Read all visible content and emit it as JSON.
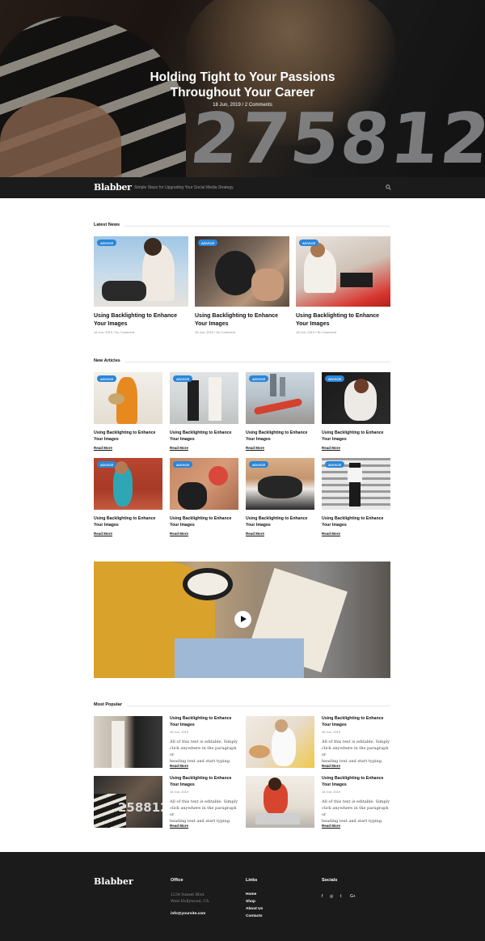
{
  "hero": {
    "title_line1": "Holding Tight to Your Passions",
    "title_line2": "Throughout Your Career",
    "meta": "18 Jun, 2019  /  2 Comments",
    "numbers": "275812"
  },
  "navbar": {
    "logo": "Blabber",
    "tagline": "Simple Steps for Upgrading Your Social Media Strategy"
  },
  "latest_news": {
    "heading": "Latest News",
    "items": [
      {
        "badge": "ADVICE",
        "title1": "Using Backlighting to Enhance",
        "title2": "Your Images",
        "meta": "18 Jun, 2019  /  No Comment"
      },
      {
        "badge": "ADVICE",
        "title1": "Using Backlighting to Enhance",
        "title2": "Your Images",
        "meta": "18 Jun, 2019  /  No Comment"
      },
      {
        "badge": "ADVICE",
        "title1": "Using Backlighting to Enhance",
        "title2": "Your Images",
        "meta": "18 Jun, 2019  /  No Comment"
      }
    ]
  },
  "new_articles": {
    "heading": "New Articles",
    "items": [
      {
        "badge": "ADVICE",
        "title1": "Using Backlighting to Enhance",
        "title2": "Your Images",
        "read_more": "Read More"
      },
      {
        "badge": "ADVICE",
        "title1": "Using Backlighting to Enhance",
        "title2": "Your Images",
        "read_more": "Read More"
      },
      {
        "badge": "ADVICE",
        "title1": "Using Backlighting to Enhance",
        "title2": "Your Images",
        "read_more": "Read More"
      },
      {
        "badge": "ADVICE",
        "title1": "Using Backlighting to Enhance",
        "title2": "Your Images",
        "read_more": "Read More"
      },
      {
        "badge": "ADVICE",
        "title1": "Using Backlighting to Enhance",
        "title2": "Your Images",
        "read_more": "Read More"
      },
      {
        "badge": "ADVICE",
        "title1": "Using Backlighting to Enhance",
        "title2": "Your Images",
        "read_more": "Read More"
      },
      {
        "badge": "ADVICE",
        "title1": "Using Backlighting to Enhance",
        "title2": "Your Images",
        "read_more": "Read More"
      },
      {
        "badge": "ADVICE",
        "title1": "Using Backlighting to Enhance",
        "title2": "Your Images",
        "read_more": "Read More"
      }
    ]
  },
  "most_popular": {
    "heading": "Most Popular",
    "items": [
      {
        "title1": "Using Backlighting to Enhance",
        "title2": "Your Images",
        "date": "18 Jun, 2019",
        "excerpt1": "All of this text is editable. Simply",
        "excerpt2": "click anywhere in the paragraph or",
        "excerpt3": "heading text and start typing.",
        "read_more": "Read More"
      },
      {
        "title1": "Using Backlighting to Enhance",
        "title2": "Your Images",
        "date": "18 Jun, 2019",
        "excerpt1": "All of this text is editable. Simply",
        "excerpt2": "click anywhere in the paragraph or",
        "excerpt3": "heading text and start typing.",
        "read_more": "Read More"
      },
      {
        "title1": "Using Backlighting to Enhance",
        "title2": "Your Images",
        "date": "18 Jun, 2019",
        "excerpt1": "All of this text is editable. Simply",
        "excerpt2": "click anywhere in the paragraph or",
        "excerpt3": "heading text and start typing.",
        "read_more": "Read More"
      },
      {
        "title1": "Using Backlighting to Enhance",
        "title2": "Your Images",
        "date": "18 Jun, 2019",
        "excerpt1": "All of this text is editable. Simply",
        "excerpt2": "click anywhere in the paragraph or",
        "excerpt3": "heading text and start typing.",
        "read_more": "Read More"
      }
    ],
    "jersey_numbers": "258812"
  },
  "footer": {
    "logo": "Blabber",
    "office": {
      "title": "Office",
      "line1": "1234 Sunset Blvd.",
      "line2": "West Hollywood, CA",
      "email": "info@yoursite.com"
    },
    "links": {
      "title": "Links",
      "items": [
        "Home",
        "Shop",
        "About Us",
        "Contacts"
      ]
    },
    "socials": {
      "title": "Socials",
      "icons": [
        "f",
        "◎",
        "t",
        "G+"
      ]
    }
  },
  "colors": {
    "accent": "#2a86d8",
    "dark": "#1b1b1b"
  },
  "icons": {
    "search": "search-icon",
    "play": "play-icon"
  }
}
